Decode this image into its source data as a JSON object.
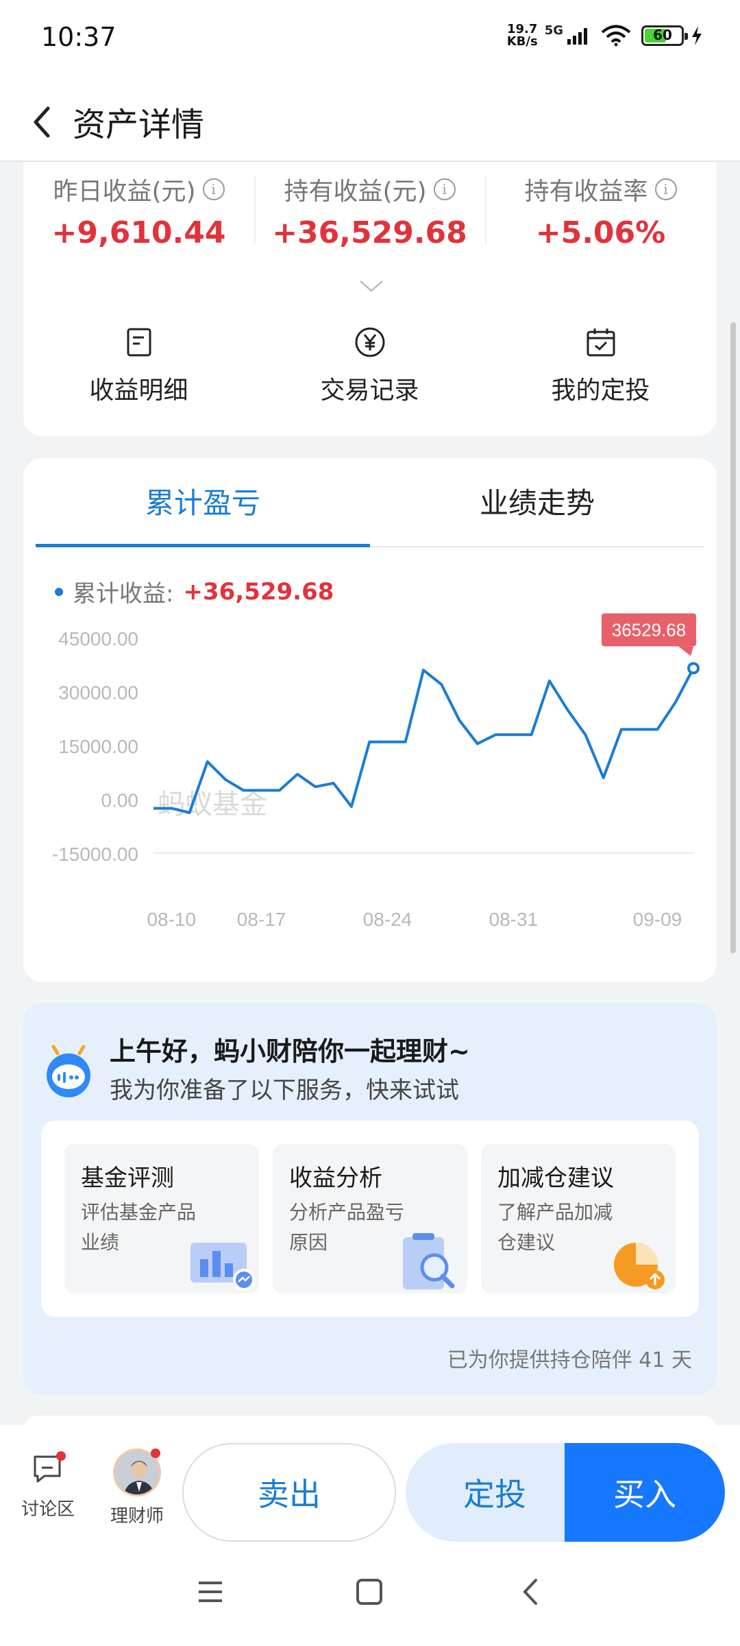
{
  "status": {
    "time": "10:37",
    "net_speed_value": "19.7",
    "net_speed_unit": "KB/s",
    "network": "5G",
    "battery": "60"
  },
  "header": {
    "title": "资产详情"
  },
  "summary": {
    "items": [
      {
        "label": "昨日收益(元)",
        "value": "+9,610.44"
      },
      {
        "label": "持有收益(元)",
        "value": "+36,529.68"
      },
      {
        "label": "持有收益率",
        "value": "+5.06%"
      }
    ],
    "quick_actions": [
      {
        "label": "收益明细",
        "icon": "document-icon"
      },
      {
        "label": "交易记录",
        "icon": "yen-circle-icon"
      },
      {
        "label": "我的定投",
        "icon": "calendar-check-icon"
      }
    ]
  },
  "chart_tabs": [
    {
      "label": "累计盈亏",
      "active": true
    },
    {
      "label": "业绩走势",
      "active": false
    }
  ],
  "legend": {
    "label": "累计收益:",
    "value": "+36,529.68"
  },
  "chart_data": {
    "type": "line",
    "yticks": [
      "45000.00",
      "30000.00",
      "15000.00",
      "0.00",
      "-15000.00"
    ],
    "ylim": [
      -15000,
      45000
    ],
    "xticks": [
      "08-10",
      "08-17",
      "08-24",
      "08-31",
      "09-09"
    ],
    "x_tick_positions": [
      1,
      6,
      13,
      20,
      28
    ],
    "callout": "36529.68",
    "watermark": "蚂蚁基金",
    "line_color": "#1a7cd6",
    "series": [
      {
        "values": [
          -2500,
          -2500,
          -3700,
          10500,
          5500,
          2500,
          2500,
          2500,
          7000,
          3500,
          4500,
          -2000,
          16000,
          16000,
          16000,
          36000,
          32000,
          22000,
          15500,
          18000,
          18000,
          18000,
          33000,
          25000,
          18000,
          6000,
          19500,
          19500,
          19500,
          27000,
          36529.68
        ]
      }
    ]
  },
  "service": {
    "greeting": "上午好，蚂小财陪你一起理财~",
    "subtitle": "我为你准备了以下服务，快来试试",
    "items": [
      {
        "title": "基金评测",
        "desc": "评估基金产品业绩"
      },
      {
        "title": "收益分析",
        "desc": "分析产品盈亏原因"
      },
      {
        "title": "加减仓建议",
        "desc": "了解产品加减仓建议"
      }
    ],
    "companion": "已为你提供持仓陪伴 41 天"
  },
  "bottom_bar": {
    "forum": "讨论区",
    "advisor": "理财师",
    "sell": "卖出",
    "sip": "定投",
    "buy": "买入"
  },
  "colors": {
    "accent": "#1a7cd6",
    "positive": "#e0333b",
    "buy": "#1677ff"
  }
}
